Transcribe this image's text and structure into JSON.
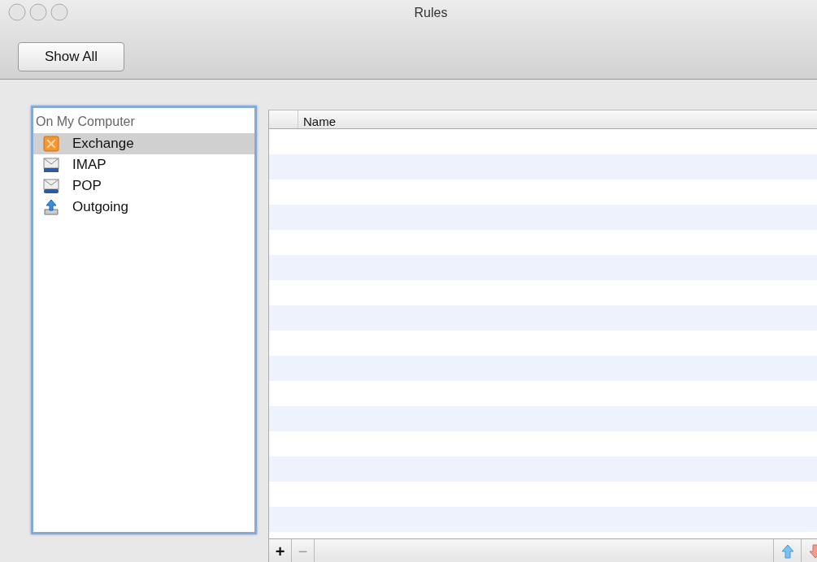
{
  "window": {
    "title": "Rules"
  },
  "toolbar": {
    "buttons": [
      "Show All"
    ]
  },
  "sidebar": {
    "header": "On My Computer",
    "items": [
      {
        "label": "Exchange",
        "kind": "exchange",
        "selected": true
      },
      {
        "label": "IMAP",
        "kind": "imap",
        "selected": false
      },
      {
        "label": "POP",
        "kind": "pop",
        "selected": false
      },
      {
        "label": "Outgoing",
        "kind": "outgoing",
        "selected": false
      }
    ]
  },
  "table": {
    "columns": [
      "Name"
    ]
  },
  "footer": {
    "add": "+",
    "remove": "−"
  }
}
